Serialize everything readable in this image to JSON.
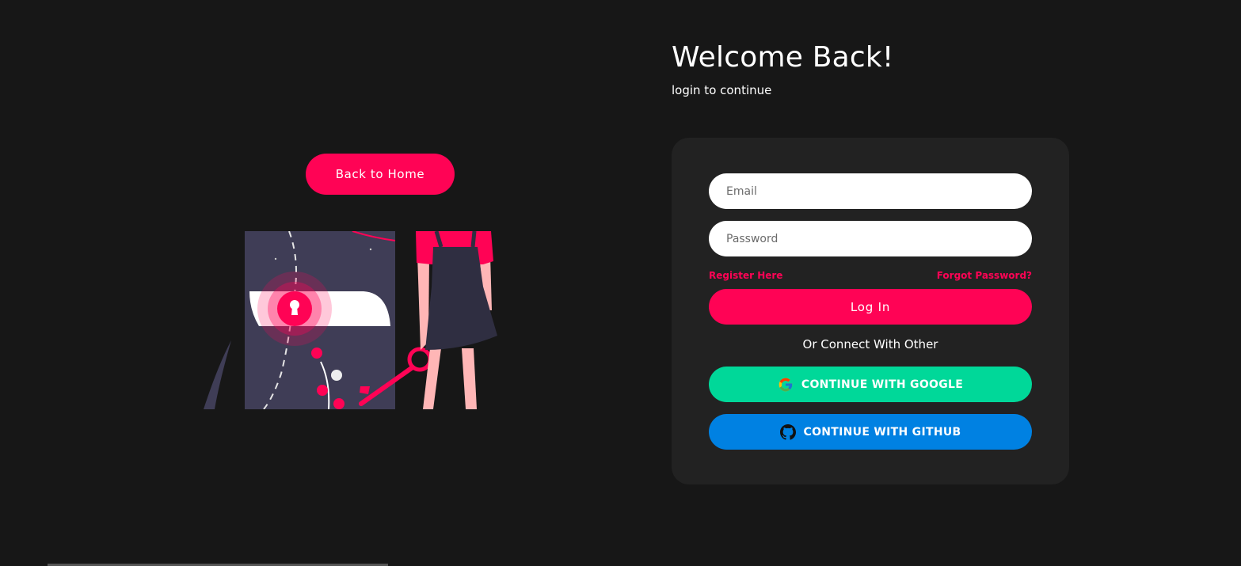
{
  "nav": {
    "back_home_label": "Back to Home"
  },
  "header": {
    "title": "Welcome Back!",
    "subtitle": "login to continue"
  },
  "form": {
    "email_placeholder": "Email",
    "password_placeholder": "Password",
    "register_label": "Register Here",
    "forgot_label": "Forgot Password?",
    "login_label": "Log In",
    "divider_text": "Or Connect With Other",
    "google_label": "CONTINUE WITH GOOGLE",
    "github_label": "CONTINUE WITH GITHUB"
  },
  "icons": {
    "google": "google-icon",
    "github": "github-icon",
    "illustration": "unlock-illustration"
  },
  "colors": {
    "background": "#171717",
    "card": "#222222",
    "accent": "#ff0355",
    "google": "#00d899",
    "github": "#0081e2"
  }
}
